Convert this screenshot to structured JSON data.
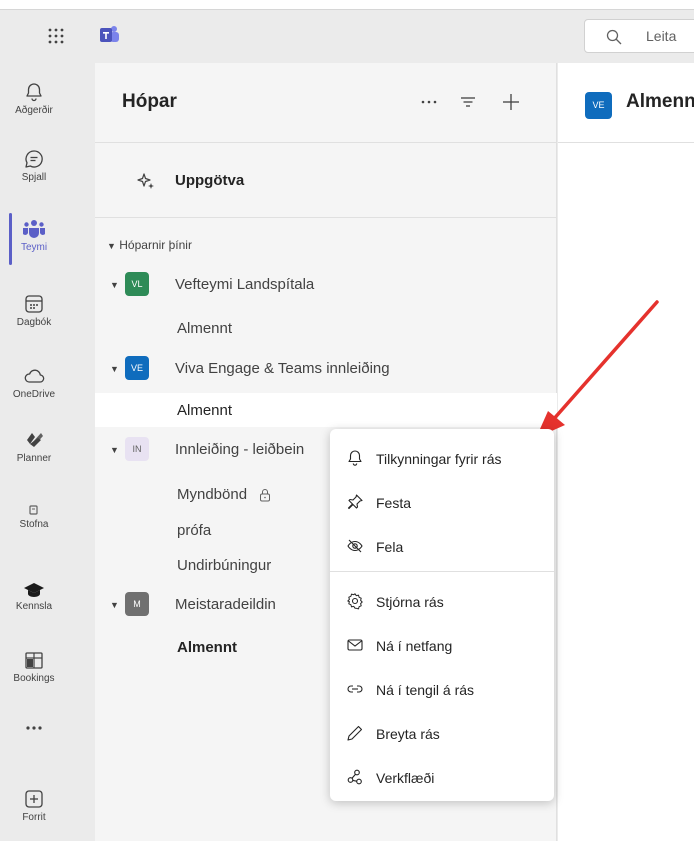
{
  "search": {
    "placeholder": "Leita"
  },
  "rail": {
    "items": [
      {
        "label": "Aðgerðir",
        "icon": "bell-icon"
      },
      {
        "label": "Spjall",
        "icon": "chat-icon"
      },
      {
        "label": "Teymi",
        "icon": "teams-icon"
      },
      {
        "label": "Dagbók",
        "icon": "calendar-icon"
      },
      {
        "label": "OneDrive",
        "icon": "cloud-icon"
      },
      {
        "label": "Planner",
        "icon": "planner-icon"
      },
      {
        "label": "Stofna",
        "icon": "stofna-icon"
      },
      {
        "label": "Kennsla",
        "icon": "graduation-cap-icon"
      },
      {
        "label": "Bookings",
        "icon": "bookings-icon"
      },
      {
        "label": "...",
        "icon": "more-icon"
      },
      {
        "label": "Forrit",
        "icon": "apps-icon"
      }
    ],
    "active": "Teymi"
  },
  "panel": {
    "title": "Hópar",
    "discover": "Uppgötva",
    "section": "Hóparnir þínir",
    "teams": [
      {
        "initials": "VL",
        "name": "Vefteymi Landspítala",
        "color": "#2e8b57",
        "channels": [
          "Almennt"
        ]
      },
      {
        "initials": "VE",
        "name": "Viva Engage & Teams innleiðing",
        "color": "#0f6cbd",
        "channels": [
          "Almennt"
        ]
      },
      {
        "initials": "IN",
        "name": "Innleiðing - leiðbein",
        "color": "#e8e2f2",
        "channels": [
          "Myndbönd",
          "prófa",
          "Undirbúningur"
        ]
      },
      {
        "initials": "M",
        "name": "Meistaradeildin",
        "color": "#707070",
        "channels": [
          "Almennt"
        ]
      }
    ]
  },
  "content": {
    "avatar": "VE",
    "title": "Almennt"
  },
  "menu": {
    "items": [
      {
        "label": "Tilkynningar fyrir rás",
        "icon": "bell-icon"
      },
      {
        "label": "Festa",
        "icon": "pin-icon"
      },
      {
        "label": "Fela",
        "icon": "eye-off-icon"
      },
      {
        "label": "Stjórna rás",
        "icon": "settings-icon"
      },
      {
        "label": "Ná í netfang",
        "icon": "mail-icon"
      },
      {
        "label": "Ná í tengil á rás",
        "icon": "link-icon"
      },
      {
        "label": "Breyta rás",
        "icon": "pencil-icon"
      },
      {
        "label": "Verkflæði",
        "icon": "workflow-icon"
      }
    ]
  },
  "colors": {
    "accent": "#5b5fc7",
    "arrow": "#e5322d"
  }
}
